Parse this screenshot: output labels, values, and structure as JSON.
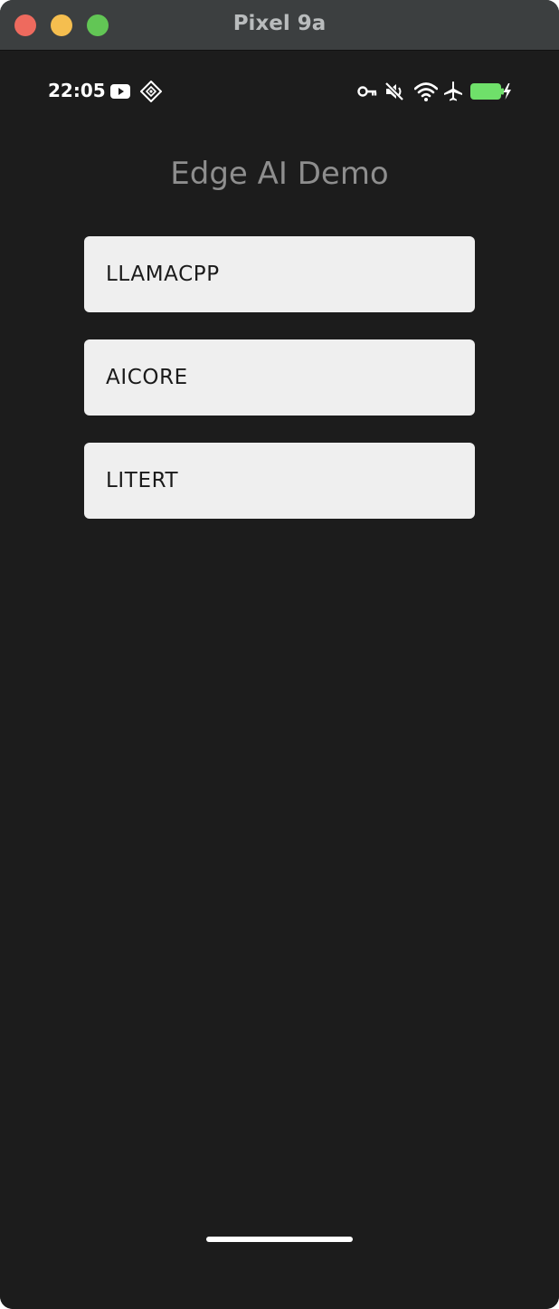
{
  "window": {
    "title": "Pixel 9a"
  },
  "status_bar": {
    "time": "22:05",
    "left_icons": [
      "youtube-icon",
      "app-notification-icon"
    ],
    "right_icons": [
      "vpn-key-icon",
      "mute-icon",
      "wifi-icon",
      "airplane-icon",
      "battery-charging-icon"
    ],
    "battery_color": "#6fe06a"
  },
  "app": {
    "title": "Edge AI Demo",
    "buttons": [
      {
        "label": "LLAMACPP"
      },
      {
        "label": "AICORE"
      },
      {
        "label": "LITERT"
      }
    ]
  },
  "colors": {
    "background": "#1c1c1c",
    "titlebar": "#3c3f40",
    "button_bg": "#efefef",
    "title_text": "#8e8e8e"
  }
}
